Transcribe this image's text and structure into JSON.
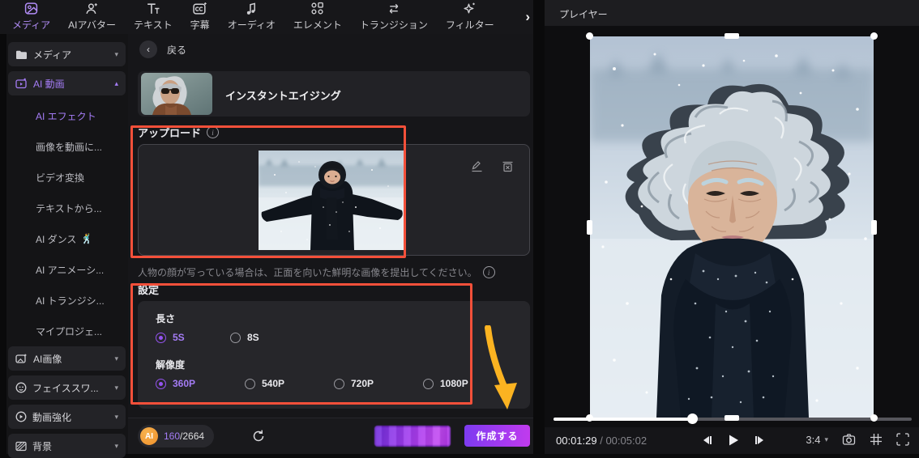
{
  "toolbar": {
    "tabs": [
      {
        "label": "メディア",
        "icon": "media-icon",
        "active": true
      },
      {
        "label": "AIアバター",
        "icon": "ai-avatar-icon",
        "active": false
      },
      {
        "label": "テキスト",
        "icon": "text-icon",
        "active": false
      },
      {
        "label": "字幕",
        "icon": "captions-icon",
        "active": false
      },
      {
        "label": "オーディオ",
        "icon": "audio-icon",
        "active": false
      },
      {
        "label": "エレメント",
        "icon": "elements-icon",
        "active": false
      },
      {
        "label": "トランジション",
        "icon": "transition-icon",
        "active": false
      },
      {
        "label": "フィルター",
        "icon": "filter-icon",
        "active": false
      }
    ]
  },
  "sidebar": {
    "groups": [
      {
        "label": "メディア",
        "icon": "folder-icon",
        "state": "collapsed"
      },
      {
        "label": "AI 動画",
        "icon": "ai-video-icon",
        "state": "expanded",
        "active": true
      }
    ],
    "ai_video_items": [
      {
        "label": "AI エフェクト",
        "active": true
      },
      {
        "label": "画像を動画に...",
        "active": false
      },
      {
        "label": "ビデオ変換",
        "active": false
      },
      {
        "label": "テキストから...",
        "active": false
      },
      {
        "label": "AI ダンス",
        "emoji": "🕺",
        "active": false
      },
      {
        "label": "AI アニメーシ...",
        "active": false
      },
      {
        "label": "AI トランジシ...",
        "active": false
      },
      {
        "label": "マイプロジェ...",
        "active": false
      }
    ],
    "groups_bottom": [
      {
        "label": "AI画像",
        "icon": "ai-image-icon"
      },
      {
        "label": "フェイススワ...",
        "icon": "face-swap-icon"
      },
      {
        "label": "動画強化",
        "icon": "video-enhance-icon"
      },
      {
        "label": "背景",
        "icon": "background-icon"
      }
    ]
  },
  "main": {
    "back_label": "戻る",
    "template": {
      "title": "インスタントエイジング",
      "thumbnail": "elderly-woman-sunglasses-thumbnail"
    },
    "upload": {
      "label": "アップロード",
      "image": "child-in-snow-photo",
      "hint": "人物の顔が写っている場合は、正面を向いた鮮明な画像を提出してください。"
    },
    "settings": {
      "label": "設定",
      "duration": {
        "label": "長さ",
        "options": [
          "5S",
          "8S"
        ],
        "selected": "5S"
      },
      "resolution": {
        "label": "解像度",
        "options": [
          "360P",
          "540P",
          "720P",
          "1080P"
        ],
        "selected": "360P"
      }
    },
    "footer": {
      "ai_badge": "AI",
      "credits_used": "160",
      "credits_total": "/2664",
      "create_label": "作成する"
    }
  },
  "player": {
    "title": "プレイヤー",
    "preview": "aged-woman-in-snow-video",
    "current_time": "00:01:29",
    "time_separator": " / ",
    "total_time": "00:05:02",
    "aspect_ratio": "3:4"
  },
  "icons": {
    "back": "‹",
    "chevron_right": "›",
    "caret_down": "▾",
    "caret_up": "▴",
    "info": "i"
  },
  "annotations": {
    "highlight_color": "#f4503a",
    "arrow_color": "#fbb321",
    "boxes": [
      "upload-section-highlight",
      "settings-section-highlight"
    ],
    "arrow_points_to": "作成する"
  },
  "colors": {
    "accent_purple": "#a47cf5",
    "selected_radio": "#9553f0",
    "create_button_gradient": [
      "#7d3bf0",
      "#c13bee"
    ],
    "ai_badge_orange": "#ee8f2a",
    "panel_bg": "#232327",
    "app_bg": "#141416"
  }
}
